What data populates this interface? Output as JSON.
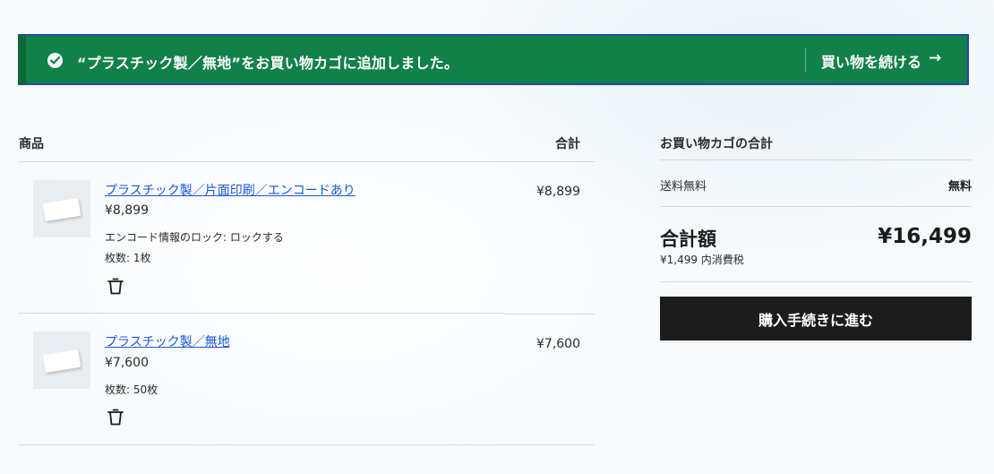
{
  "banner": {
    "message": "“プラスチック製／無地”をお買い物カゴに追加しました。",
    "continue_label": "買い物を続ける",
    "arrow": "→"
  },
  "cart": {
    "col_product": "商品",
    "col_total": "合計",
    "items": [
      {
        "name": "プラスチック製／片面印刷／エンコードあり",
        "price": "¥8,899",
        "meta": [
          "エンコード情報のロック: ロックする",
          "枚数: 1枚"
        ],
        "line_total": "¥8,899"
      },
      {
        "name": "プラスチック製／無地",
        "price": "¥7,600",
        "meta": [
          "枚数: 50枚"
        ],
        "line_total": "¥7,600"
      }
    ]
  },
  "summary": {
    "title": "お買い物カゴの合計",
    "shipping_label": "送料無料",
    "shipping_value": "無料",
    "total_label": "合計額",
    "tax_note": "¥1,499 内消費税",
    "total_value": "¥16,499",
    "checkout_label": "購入手続きに進む"
  },
  "colors": {
    "banner_bg": "#118149",
    "banner_border": "#1f4aa8",
    "link": "#1a58d6",
    "checkout_bg": "#1c1c1c"
  },
  "icons": {
    "banner_status": "check-circle-icon",
    "continue_arrow": "arrow-right-icon",
    "remove_item": "trash-icon"
  }
}
